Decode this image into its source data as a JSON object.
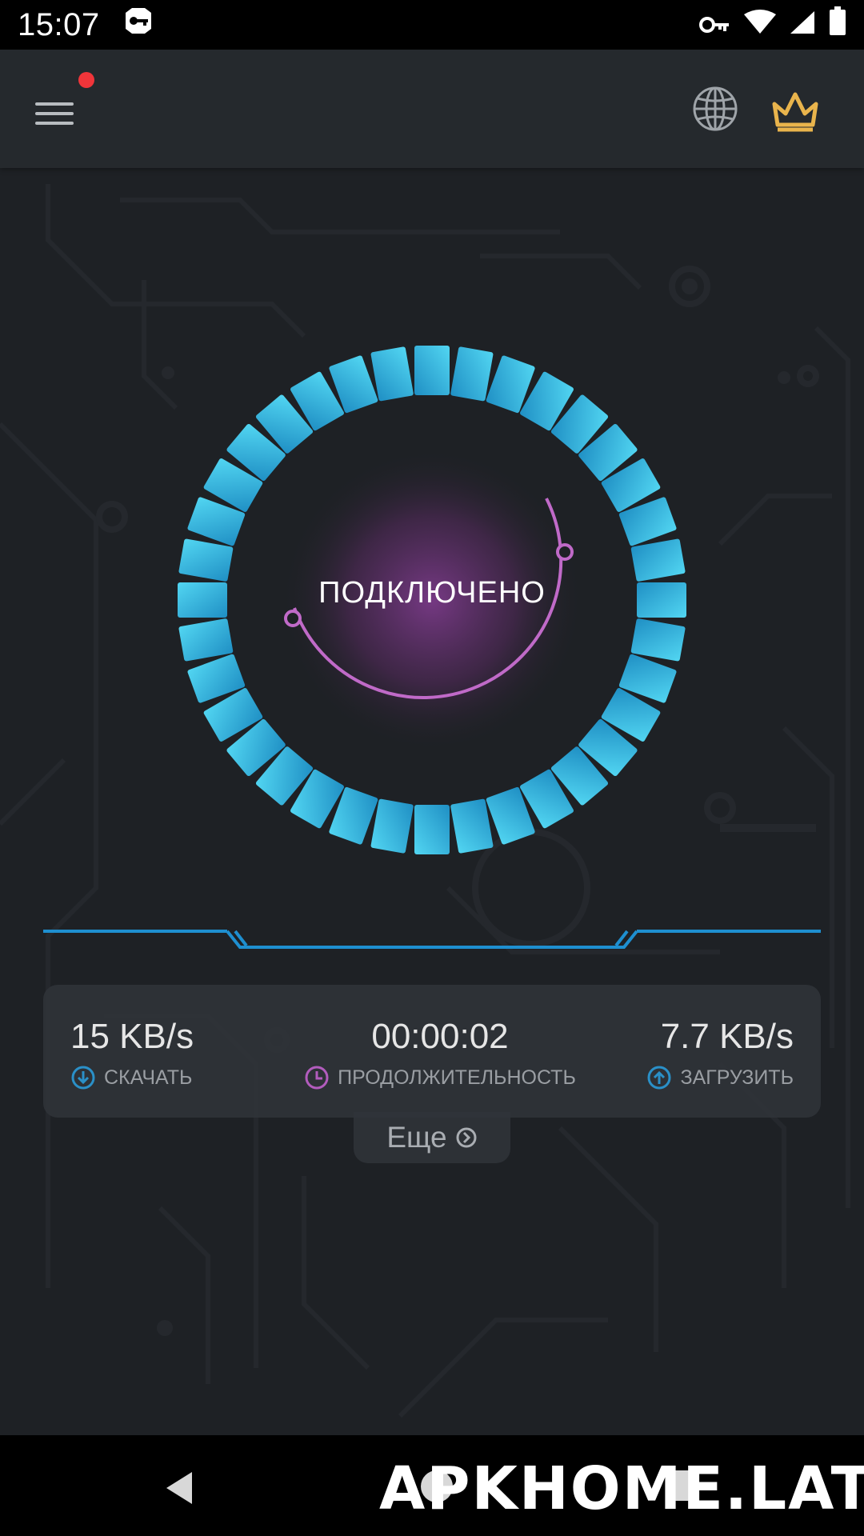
{
  "status_bar": {
    "time": "15:07"
  },
  "app_bar": {
    "has_notification": true,
    "colors": {
      "crown": "#e9b44c",
      "notification": "#f0353a"
    }
  },
  "connection": {
    "status_text": "ПОДКЛЮЧЕНО",
    "colors": {
      "ring": "#2aa8dc",
      "ring_light": "#4fd2f0",
      "inner_arc": "#c06ac8"
    }
  },
  "stats": {
    "download": {
      "value": "15 KB/s",
      "label": "СКАЧАТЬ",
      "icon": "download-arrow-icon"
    },
    "duration": {
      "value": "00:00:02",
      "label": "ПРОДОЛЖИТЕЛЬНОСТЬ",
      "icon": "clock-icon"
    },
    "upload": {
      "value": "7.7 KB/s",
      "label": "ЗАГРУЗИТЬ",
      "icon": "upload-arrow-icon"
    }
  },
  "more": {
    "label": "Еще"
  },
  "watermark": "APKHOME.LAT"
}
